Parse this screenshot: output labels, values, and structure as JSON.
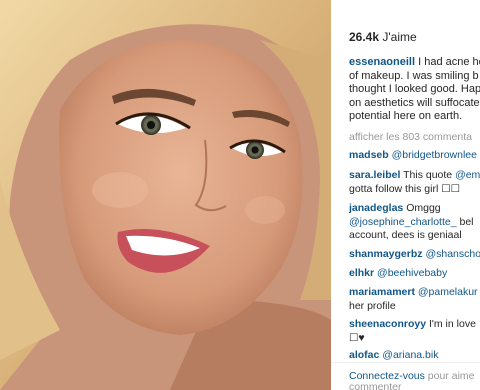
{
  "likes": {
    "count": "26.4k",
    "suffix": " J'aime"
  },
  "caption": {
    "username": "essenaoneill",
    "lines": [
      "I had acne he",
      "of makeup. I was smiling b",
      "thought I looked good. Hap",
      "on aesthetics will suffocate",
      "potential here on earth."
    ]
  },
  "view_all_comments": "afficher les 803 commenta",
  "comments": [
    {
      "user": "madseb",
      "mention": "@bridgetbrownlee",
      "text": ""
    },
    {
      "user": "sara.leibel",
      "mention": "",
      "text": "This quote",
      "mention2": "@em",
      "line2": "gotta follow this girl ☐☐"
    },
    {
      "user": "janadeglas",
      "text": "Omggg",
      "mention": "@josephine_charlotte_",
      "line2b": " bel",
      "line3": "account, dees is geniaal"
    },
    {
      "user": "shanmaygerbz",
      "mention": "@shanscho"
    },
    {
      "user": "elhkr",
      "mention": "@beehivebaby"
    },
    {
      "user": "mariamamert",
      "mention": "@pamelakur",
      "line2": "her profile"
    },
    {
      "user": "sheenaconroyy",
      "text": "I'm in love",
      "line2": "☐♥"
    },
    {
      "user": "alofac",
      "mention": "@ariana.bik"
    }
  ],
  "footer": {
    "link": "Connectez-vous",
    "text": " pour aime",
    "line2": "commenter"
  },
  "colors": {
    "username": "#125688",
    "muted": "#999999",
    "text": "#262626"
  }
}
